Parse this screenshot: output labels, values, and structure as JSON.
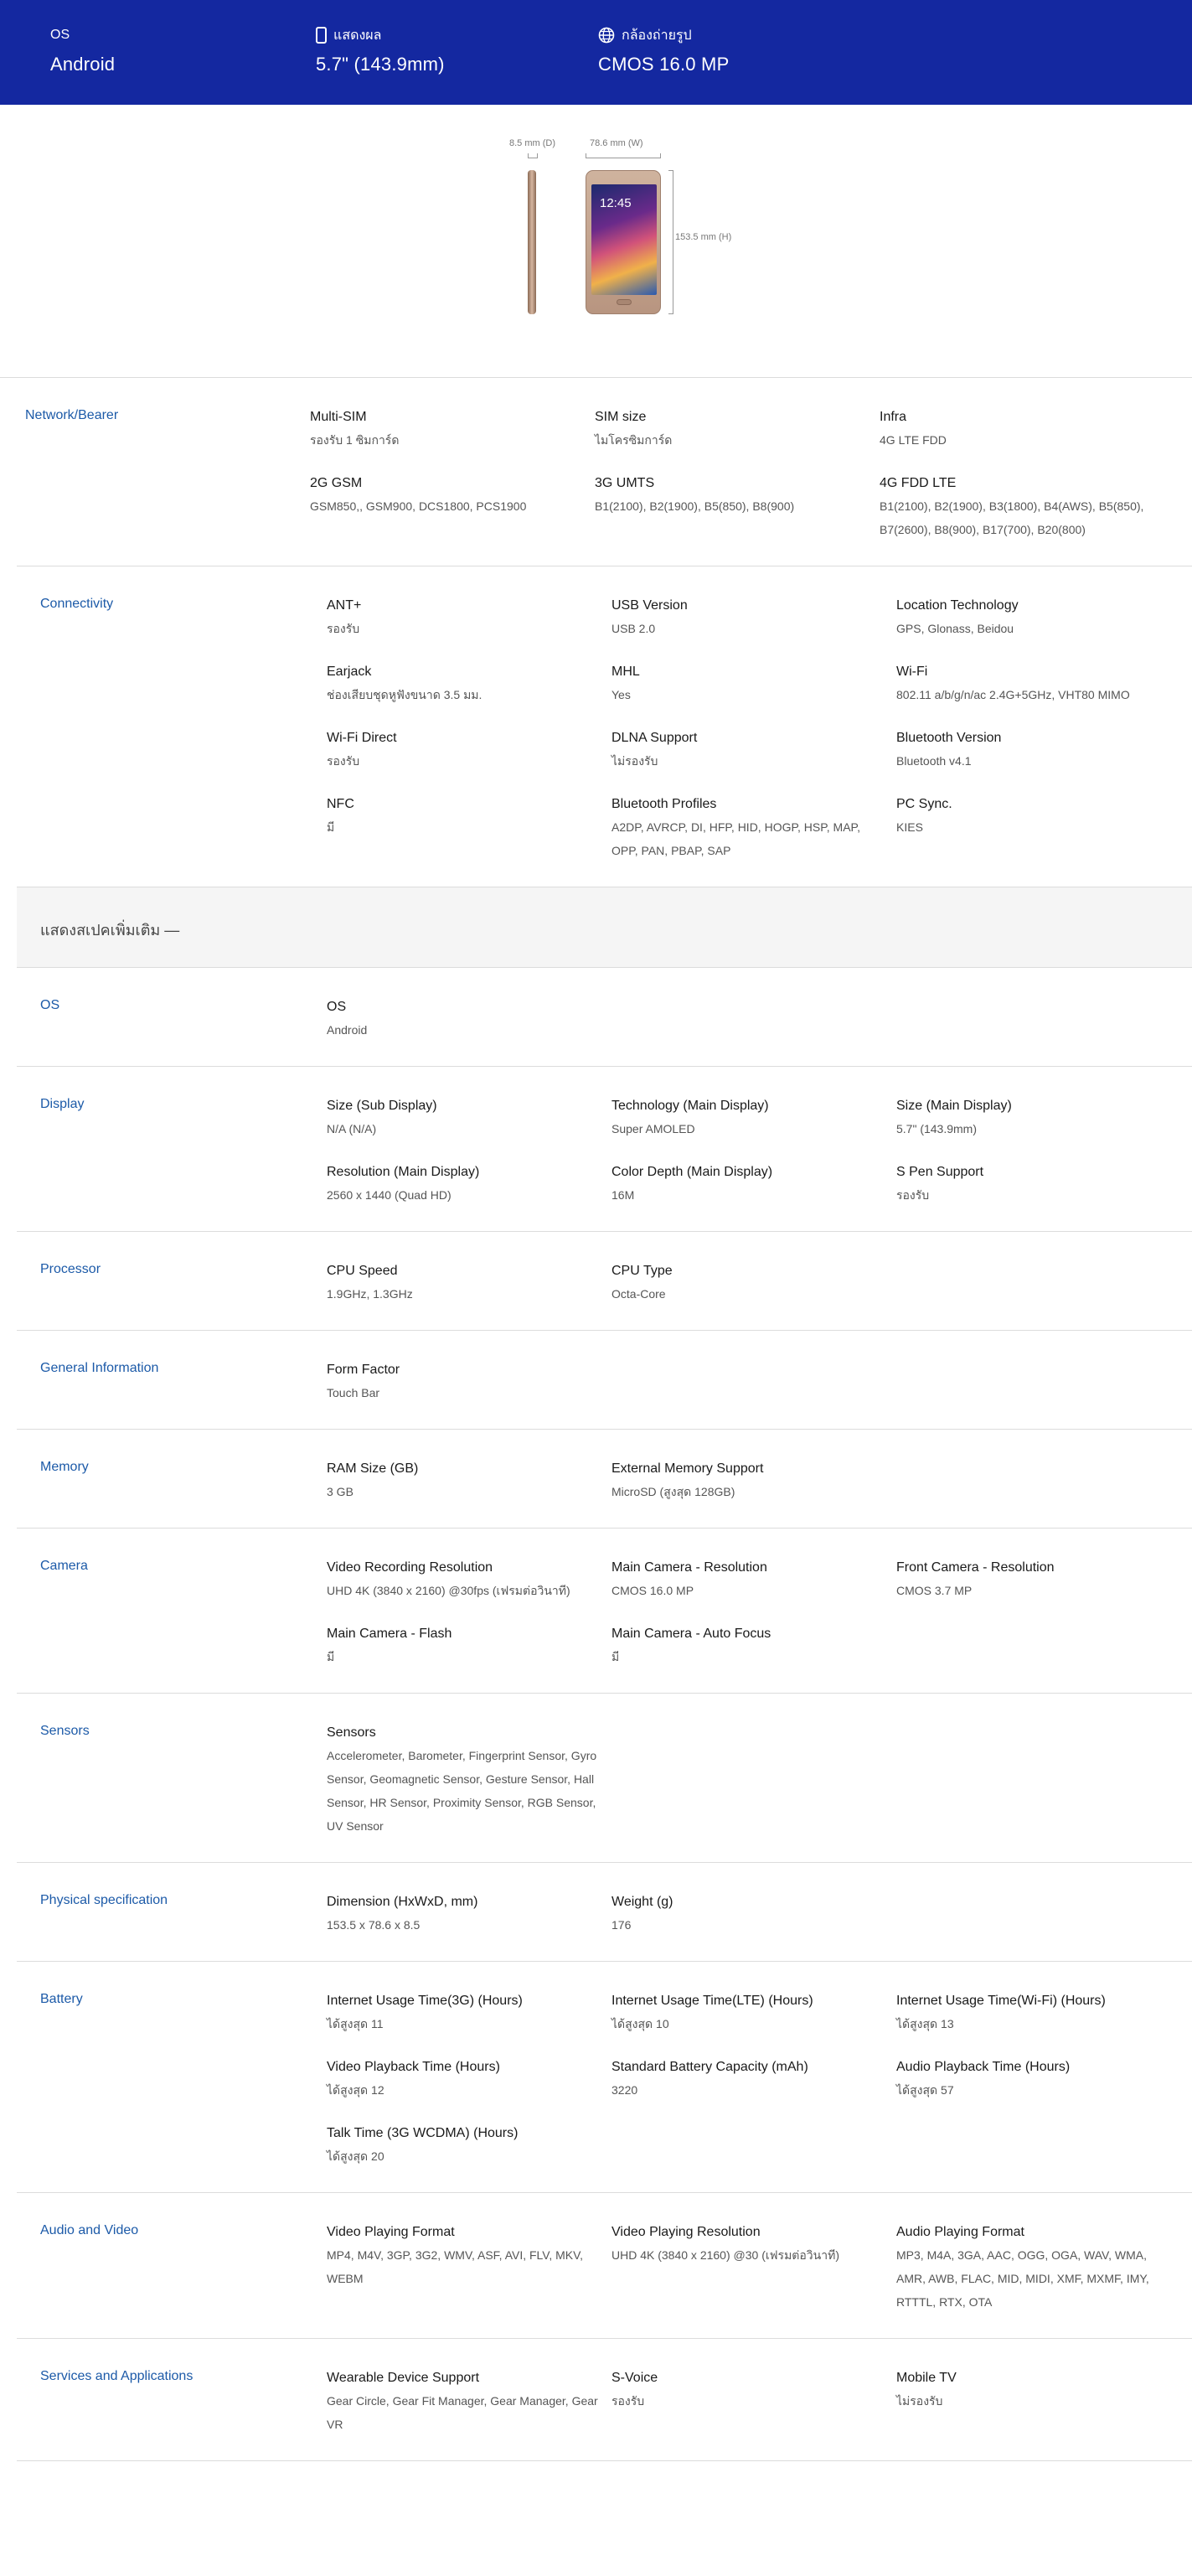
{
  "hero": {
    "os": {
      "label": "OS",
      "value": "Android"
    },
    "display": {
      "label": "แสดงผล",
      "value": "5.7\" (143.9mm)"
    },
    "camera": {
      "label": "กล้องถ่ายรูป",
      "value": "CMOS 16.0 MP"
    }
  },
  "device": {
    "depth": "8.5 mm (D)",
    "width": "78.6 mm (W)",
    "height": "153.5 mm (H)",
    "screen_time": "12:45"
  },
  "more_specs_label": "แสดงสเปคเพิ่มเติม —",
  "sections": [
    {
      "title": "Network/Bearer",
      "items": [
        {
          "label": "Multi-SIM",
          "value": "รองรับ 1 ซิมการ์ด"
        },
        {
          "label": "SIM size",
          "value": "ไมโครซิมการ์ด"
        },
        {
          "label": "Infra",
          "value": "4G LTE FDD"
        },
        {
          "label": "2G GSM",
          "value": "GSM850,, GSM900, DCS1800, PCS1900"
        },
        {
          "label": "3G UMTS",
          "value": "B1(2100), B2(1900), B5(850), B8(900)"
        },
        {
          "label": "4G FDD LTE",
          "value": "B1(2100), B2(1900), B3(1800), B4(AWS), B5(850), B7(2600), B8(900), B17(700), B20(800)"
        }
      ]
    },
    {
      "title": "Connectivity",
      "items": [
        {
          "label": "ANT+",
          "value": "รองรับ"
        },
        {
          "label": "USB Version",
          "value": "USB 2.0"
        },
        {
          "label": "Location Technology",
          "value": "GPS, Glonass, Beidou"
        },
        {
          "label": "Earjack",
          "value": "ช่องเสียบชุดหูฟังขนาด 3.5 มม."
        },
        {
          "label": "MHL",
          "value": "Yes"
        },
        {
          "label": "Wi-Fi",
          "value": "802.11 a/b/g/n/ac 2.4G+5GHz, VHT80 MIMO"
        },
        {
          "label": "Wi-Fi Direct",
          "value": "รองรับ"
        },
        {
          "label": "DLNA Support",
          "value": "ไม่รองรับ"
        },
        {
          "label": "Bluetooth Version",
          "value": "Bluetooth v4.1"
        },
        {
          "label": "NFC",
          "value": "มี"
        },
        {
          "label": "Bluetooth Profiles",
          "value": "A2DP, AVRCP, DI, HFP, HID, HOGP, HSP, MAP, OPP, PAN, PBAP, SAP"
        },
        {
          "label": "PC Sync.",
          "value": "KIES"
        }
      ]
    },
    {
      "title": "OS",
      "items": [
        {
          "label": "OS",
          "value": "Android"
        }
      ]
    },
    {
      "title": "Display",
      "items": [
        {
          "label": "Size (Sub Display)",
          "value": "N/A (N/A)"
        },
        {
          "label": "Technology (Main Display)",
          "value": "Super AMOLED"
        },
        {
          "label": "Size (Main Display)",
          "value": "5.7\" (143.9mm)"
        },
        {
          "label": "Resolution (Main Display)",
          "value": "2560 x 1440 (Quad HD)"
        },
        {
          "label": "Color Depth (Main Display)",
          "value": "16M"
        },
        {
          "label": "S Pen Support",
          "value": "รองรับ"
        }
      ]
    },
    {
      "title": "Processor",
      "items": [
        {
          "label": "CPU Speed",
          "value": "1.9GHz, 1.3GHz"
        },
        {
          "label": "CPU Type",
          "value": "Octa-Core"
        }
      ]
    },
    {
      "title": "General Information",
      "items": [
        {
          "label": "Form Factor",
          "value": "Touch Bar"
        }
      ]
    },
    {
      "title": "Memory",
      "items": [
        {
          "label": "RAM Size (GB)",
          "value": "3 GB"
        },
        {
          "label": "External Memory Support",
          "value": "MicroSD (สูงสุด 128GB)"
        }
      ]
    },
    {
      "title": "Camera",
      "items": [
        {
          "label": "Video Recording Resolution",
          "value": "UHD 4K (3840 x 2160) @30fps (เฟรมต่อวินาที)"
        },
        {
          "label": "Main Camera - Resolution",
          "value": "CMOS 16.0 MP"
        },
        {
          "label": "Front Camera - Resolution",
          "value": "CMOS 3.7 MP"
        },
        {
          "label": "Main Camera - Flash",
          "value": "มี"
        },
        {
          "label": "Main Camera - Auto Focus",
          "value": "มี"
        }
      ]
    },
    {
      "title": "Sensors",
      "items": [
        {
          "label": "Sensors",
          "value": "Accelerometer, Barometer, Fingerprint Sensor, Gyro Sensor, Geomagnetic Sensor, Gesture Sensor, Hall Sensor, HR Sensor, Proximity Sensor, RGB Sensor, UV Sensor"
        }
      ]
    },
    {
      "title": "Physical specification",
      "items": [
        {
          "label": "Dimension (HxWxD, mm)",
          "value": "153.5 x 78.6 x 8.5"
        },
        {
          "label": "Weight (g)",
          "value": "176"
        }
      ]
    },
    {
      "title": "Battery",
      "items": [
        {
          "label": "Internet Usage Time(3G) (Hours)",
          "value": "ได้สูงสุด 11"
        },
        {
          "label": "Internet Usage Time(LTE) (Hours)",
          "value": "ได้สูงสุด 10"
        },
        {
          "label": "Internet Usage Time(Wi-Fi) (Hours)",
          "value": "ได้สูงสุด 13"
        },
        {
          "label": "Video Playback Time (Hours)",
          "value": "ได้สูงสุด 12"
        },
        {
          "label": "Standard Battery Capacity (mAh)",
          "value": "3220"
        },
        {
          "label": "Audio Playback Time (Hours)",
          "value": "ได้สูงสุด 57"
        },
        {
          "label": "Talk Time (3G WCDMA) (Hours)",
          "value": "ได้สูงสุด 20"
        }
      ]
    },
    {
      "title": "Audio and Video",
      "items": [
        {
          "label": "Video Playing Format",
          "value": "MP4, M4V, 3GP, 3G2, WMV, ASF, AVI, FLV, MKV, WEBM"
        },
        {
          "label": "Video Playing Resolution",
          "value": "UHD 4K (3840 x 2160) @30 (เฟรมต่อวินาที)"
        },
        {
          "label": "Audio Playing Format",
          "value": "MP3, M4A, 3GA, AAC, OGG, OGA, WAV, WMA, AMR, AWB, FLAC, MID, MIDI, XMF, MXMF, IMY, RTTTL, RTX, OTA"
        }
      ]
    },
    {
      "title": "Services and Applications",
      "items": [
        {
          "label": "Wearable Device Support",
          "value": "Gear Circle, Gear Fit Manager, Gear Manager, Gear VR"
        },
        {
          "label": "S-Voice",
          "value": "รองรับ"
        },
        {
          "label": "Mobile TV",
          "value": "ไม่รองรับ"
        }
      ]
    }
  ]
}
